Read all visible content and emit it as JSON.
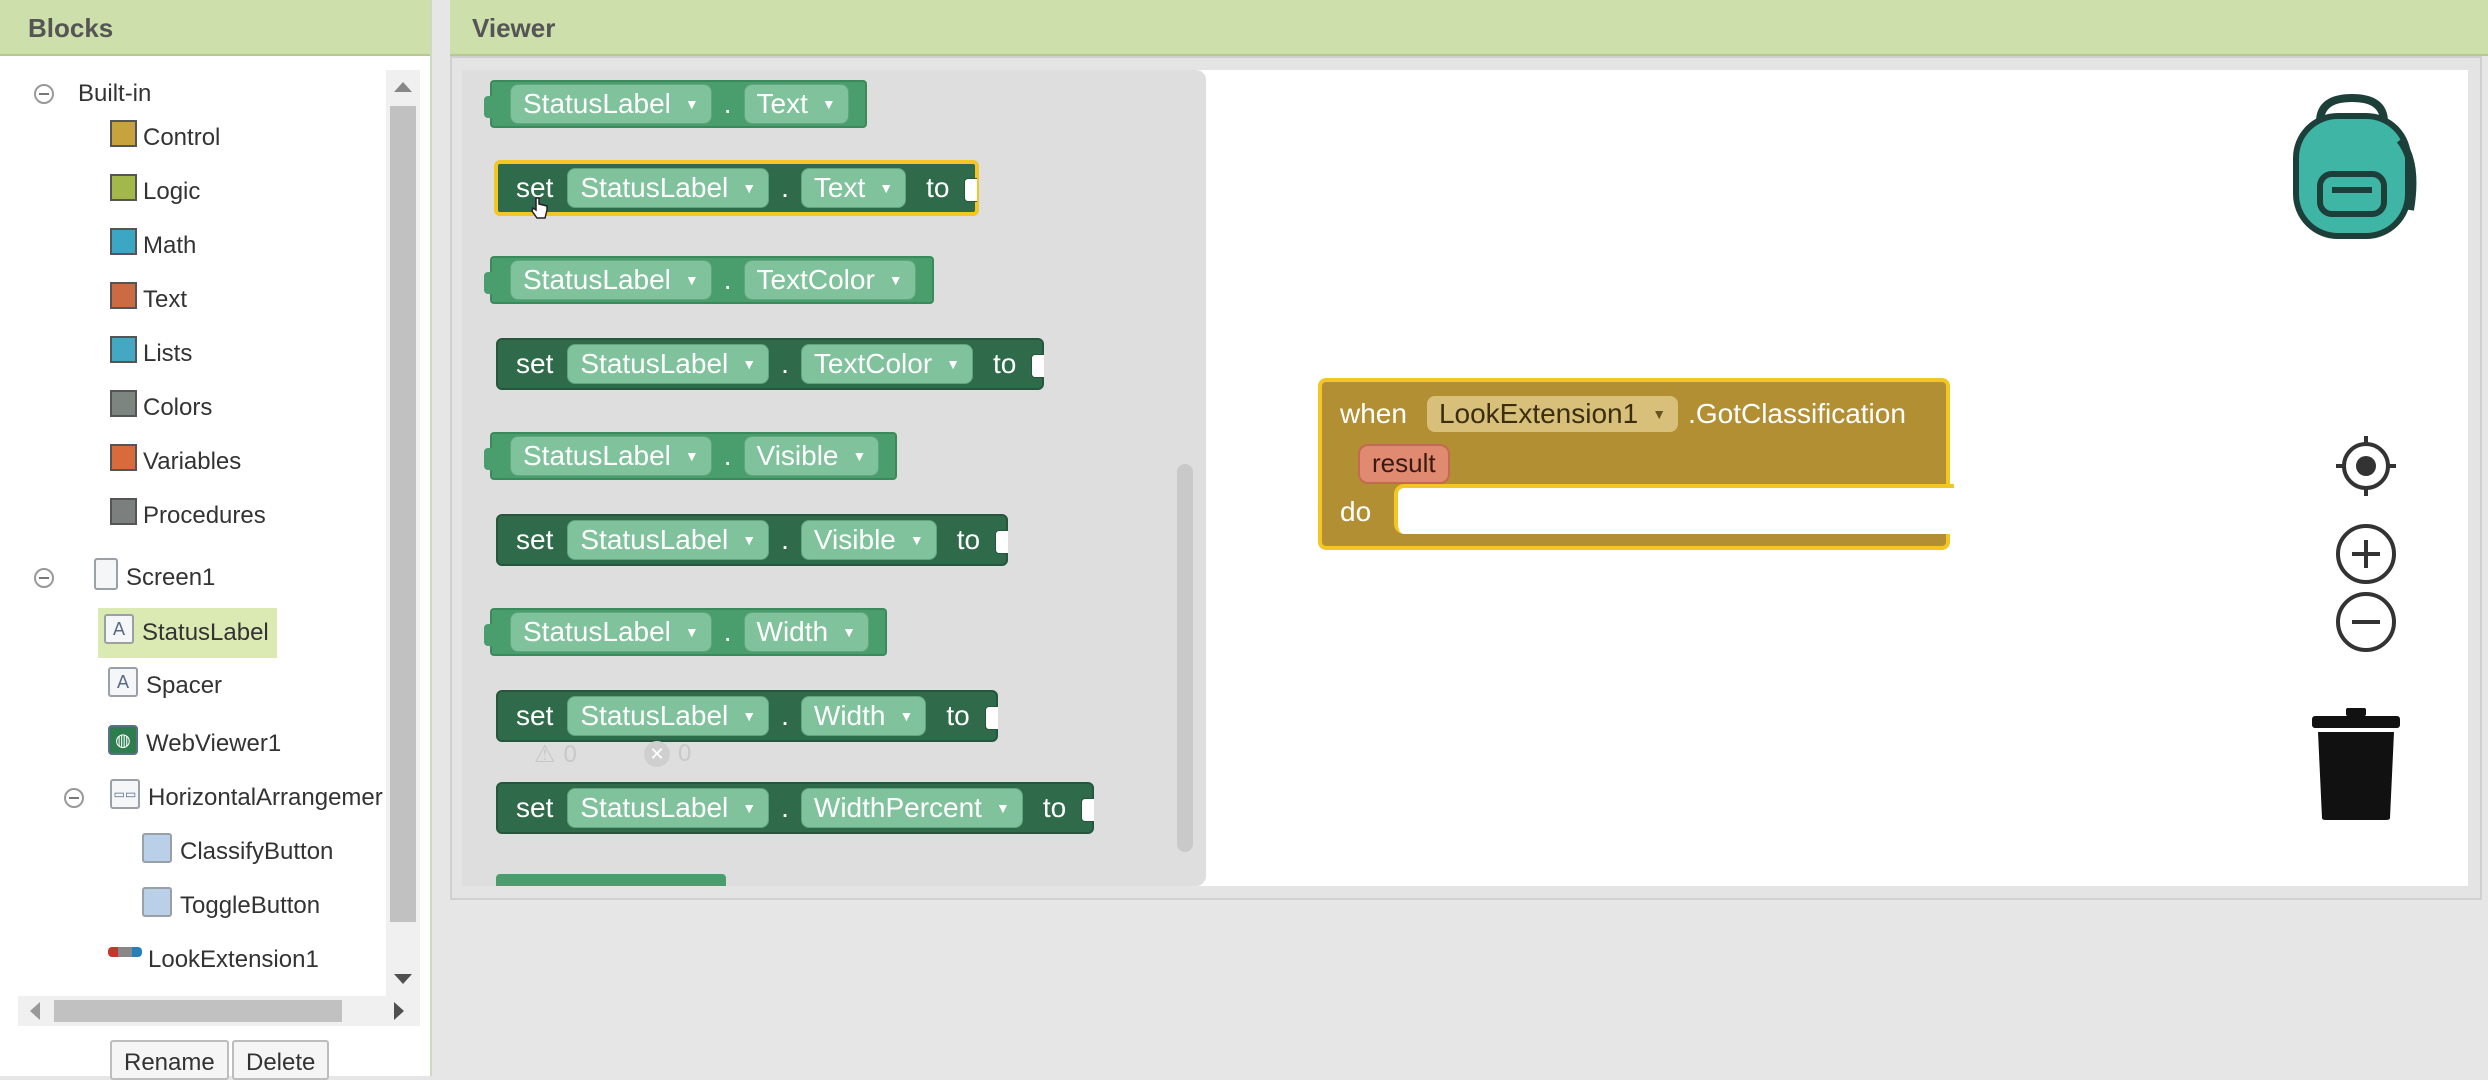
{
  "blocks_panel": {
    "title": "Blocks",
    "builtin": {
      "label": "Built-in",
      "items": [
        {
          "label": "Control",
          "color": "#c8a23c"
        },
        {
          "label": "Logic",
          "color": "#a3b84a"
        },
        {
          "label": "Math",
          "color": "#3ba7c4"
        },
        {
          "label": "Text",
          "color": "#cc6a44"
        },
        {
          "label": "Lists",
          "color": "#44a8c4"
        },
        {
          "label": "Colors",
          "color": "#7d8580"
        },
        {
          "label": "Variables",
          "color": "#d86a3c"
        },
        {
          "label": "Procedures",
          "color": "#7b7f7d"
        }
      ]
    },
    "screen": {
      "label": "Screen1",
      "components": {
        "status_label": "StatusLabel",
        "spacer": "Spacer",
        "webviewer": "WebViewer1",
        "arrangement": "HorizontalArrangemer",
        "classify_button": "ClassifyButton",
        "toggle_button": "ToggleButton",
        "look_extension": "LookExtension1"
      }
    },
    "rename_label": "Rename",
    "delete_label": "Delete"
  },
  "viewer": {
    "title": "Viewer",
    "flyout": {
      "component": "StatusLabel",
      "set_kw": "set",
      "to_kw": "to",
      "dot": ".",
      "props": {
        "text": "Text",
        "text_color": "TextColor",
        "visible": "Visible",
        "width": "Width",
        "width_percent": "WidthPercent"
      }
    },
    "warnings_count": "0",
    "errors_count": "0",
    "event": {
      "when_kw": "when",
      "component": "LookExtension1",
      "event_name": ".GotClassification",
      "param": "result",
      "do_kw": "do"
    }
  }
}
